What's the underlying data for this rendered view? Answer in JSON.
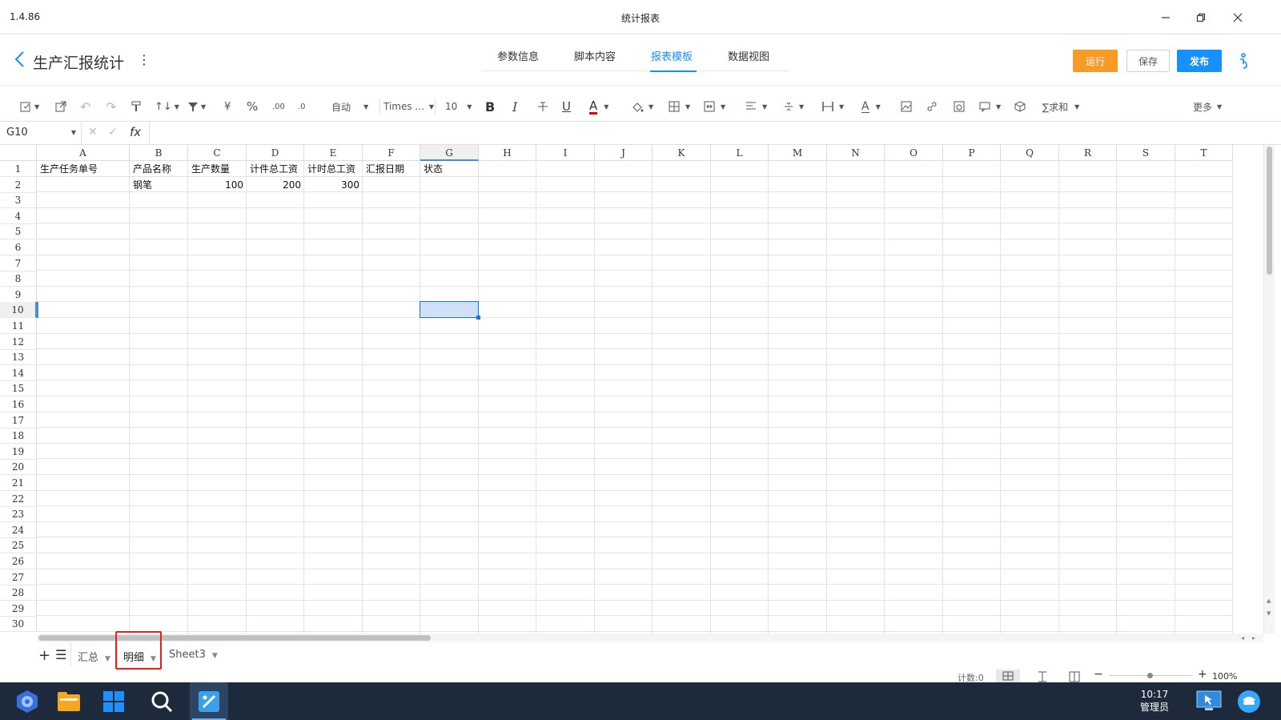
{
  "window": {
    "version": "1.4.86",
    "title": "统计报表"
  },
  "header": {
    "report_name": "生产汇报统计",
    "tabs": [
      "参数信息",
      "脚本内容",
      "报表模板",
      "数据视图"
    ],
    "active_tab": "报表模板",
    "buttons": {
      "run": "运行",
      "save": "保存",
      "publish": "发布"
    },
    "colors": {
      "run": "#f79b27",
      "publish": "#1890ff",
      "accent": "#1890ff"
    }
  },
  "toolbar": {
    "format": "自动",
    "font": "Times ...",
    "font_size": "10",
    "bold": "B",
    "italic": "I",
    "underline": "U",
    "font_color_letter": "A",
    "sum": "∑求和",
    "more": "更多",
    "currency": "¥",
    "percent": "%"
  },
  "formula_bar": {
    "cell_ref": "G10",
    "fx": "fx",
    "content": ""
  },
  "sheet": {
    "columns": [
      "A",
      "B",
      "C",
      "D",
      "E",
      "F",
      "G",
      "H",
      "I",
      "J",
      "K",
      "L",
      "M",
      "N",
      "O",
      "P",
      "Q",
      "R",
      "S",
      "T"
    ],
    "selected_column": "G",
    "selected_row": 10,
    "visible_rows": 30,
    "row1": [
      "生产任务单号",
      "产品名称",
      "生产数量",
      "计件总工资",
      "计时总工资",
      "汇报日期",
      "状态"
    ],
    "row2": {
      "B": "钢笔",
      "C": "100",
      "D": "200",
      "E": "300"
    }
  },
  "sheet_tabs": [
    "汇总",
    "明细",
    "Sheet3"
  ],
  "active_sheet": "明细",
  "status_bar": {
    "count": "计数:0",
    "zoom": "100%"
  },
  "taskbar": {
    "time": "10:17",
    "user": "管理员"
  }
}
